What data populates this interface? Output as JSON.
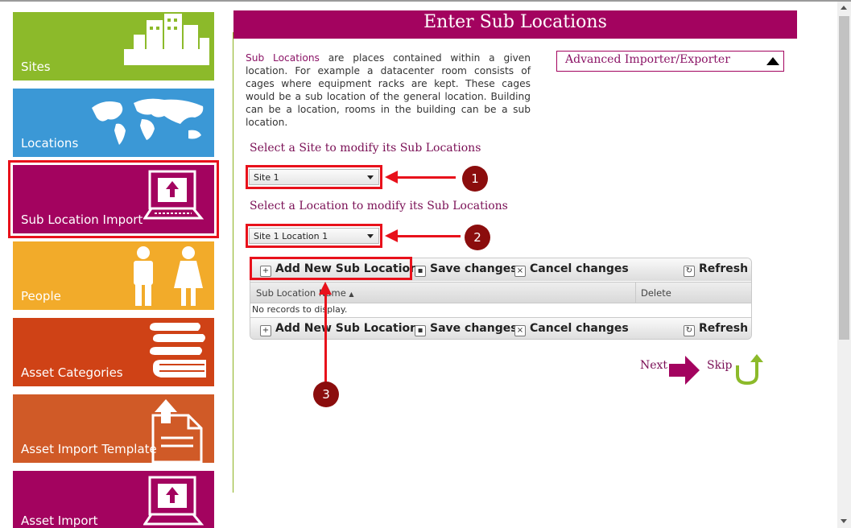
{
  "sidebar": {
    "items": [
      {
        "label": "Sites",
        "color": "#8cba2a",
        "icon": "buildings-icon"
      },
      {
        "label": "Locations",
        "color": "#3b98d6",
        "icon": "world-map-icon"
      },
      {
        "label": "Sub Location Import",
        "color": "#a3035f",
        "icon": "computer-upload-icon",
        "selected": true
      },
      {
        "label": "People",
        "color": "#f2ab2a",
        "icon": "people-icon"
      },
      {
        "label": "Asset Categories",
        "color": "#cf4216",
        "icon": "books-icon"
      },
      {
        "label": "Asset Import Template",
        "color": "#d05a27",
        "icon": "document-upload-icon"
      },
      {
        "label": "Asset Import",
        "color": "#a3035f",
        "icon": "computer-upload-icon"
      }
    ]
  },
  "main": {
    "title": "Enter Sub Locations",
    "description_highlight": "Sub Locations",
    "description_rest": " are places contained within a given location. For example a datacenter room consists of cages where equipment racks are kept. These cages would be a sub location of the general location. Building can be a location, rooms in the building can be a sub location.",
    "advanced_label": "Advanced Importer/Exporter",
    "site_prompt": "Select a Site to modify its Sub Locations",
    "site_value": "Site 1",
    "location_prompt": "Select a Location to modify its Sub Locations",
    "location_value": "Site 1 Location 1",
    "grid": {
      "add_label": "Add New Sub Location",
      "save_label": "Save changes",
      "cancel_label": "Cancel changes",
      "refresh_label": "Refresh",
      "col_name": "Sub Location Name",
      "col_delete": "Delete",
      "empty_text": "No records to display."
    },
    "next_label": "Next",
    "skip_label": "Skip"
  },
  "annotations": [
    "1",
    "2",
    "3"
  ],
  "colors": {
    "accent": "#a3035f",
    "highlight_red": "#e8111b",
    "badge": "#8b0d0d",
    "divider": "#8db21f"
  }
}
